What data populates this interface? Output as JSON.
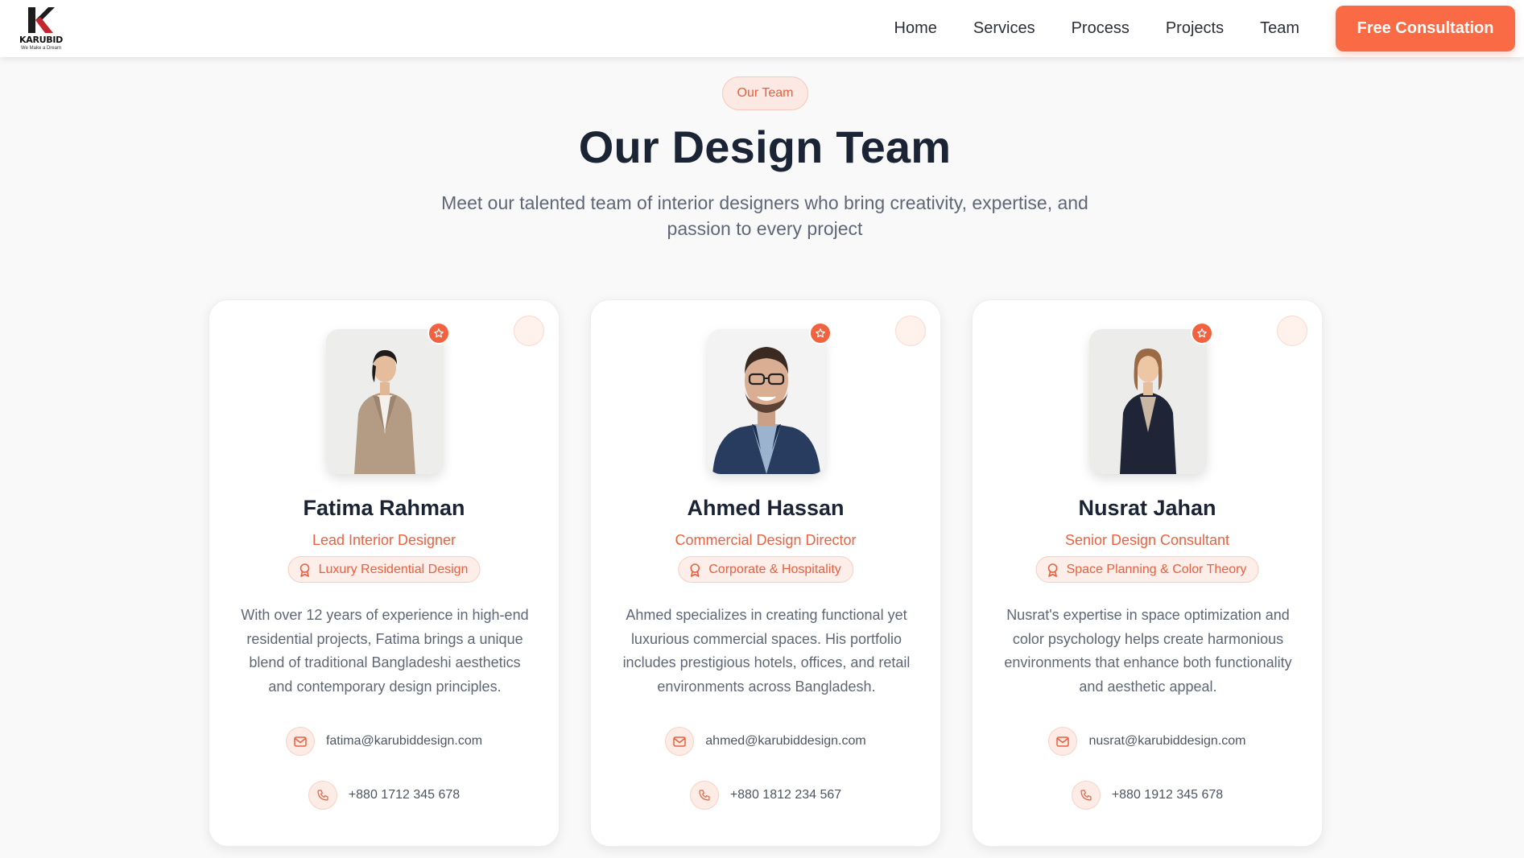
{
  "brand": {
    "name": "KARUBID",
    "tagline": "We Make a Dream"
  },
  "nav": {
    "items": [
      "Home",
      "Services",
      "Process",
      "Projects",
      "Team"
    ],
    "cta_label": "Free Consultation"
  },
  "section": {
    "badge": "Our Team",
    "title": "Our Design Team",
    "subtitle": "Meet our talented team of interior designers who bring creativity, expertise, and passion to every project"
  },
  "colors": {
    "accent": "#fa6a45",
    "heading": "#1b2434",
    "body_text": "#5f6776"
  },
  "team": [
    {
      "name": "Fatima Rahman",
      "role": "Lead Interior Designer",
      "specialty": "Luxury Residential Design",
      "bio": "With over 12 years of experience in high-end residential projects, Fatima brings a unique blend of traditional Bangladeshi aesthetics and contemporary design principles.",
      "email": "fatima@karubiddesign.com",
      "phone": "+880 1712 345 678",
      "photo": "portrait-woman-beige-suit"
    },
    {
      "name": "Ahmed Hassan",
      "role": "Commercial Design Director",
      "specialty": "Corporate & Hospitality",
      "bio": "Ahmed specializes in creating functional yet luxurious commercial spaces. His portfolio includes prestigious hotels, offices, and retail environments across Bangladesh.",
      "email": "ahmed@karubiddesign.com",
      "phone": "+880 1812 234 567",
      "photo": "portrait-man-navy-blazer"
    },
    {
      "name": "Nusrat Jahan",
      "role": "Senior Design Consultant",
      "specialty": "Space Planning & Color Theory",
      "bio": "Nusrat's expertise in space optimization and color psychology helps create harmonious environments that enhance both functionality and aesthetic appeal.",
      "email": "nusrat@karubiddesign.com",
      "phone": "+880 1912 345 678",
      "photo": "portrait-woman-black-suit"
    }
  ],
  "icons": {
    "star": "star-icon",
    "specialty": "award-icon",
    "email": "mail-icon",
    "phone": "phone-icon"
  }
}
